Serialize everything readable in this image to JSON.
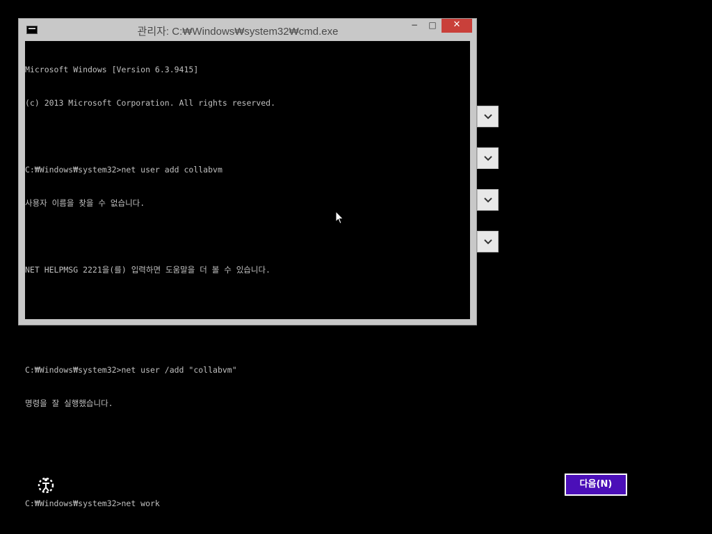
{
  "window": {
    "title": "관리자: C:₩Windows₩system32₩cmd.exe",
    "minimize_glyph": "−",
    "maximize_glyph": "□",
    "close_glyph": "✕"
  },
  "console": {
    "lines": [
      "Microsoft Windows [Version 6.3.9415]",
      "(c) 2013 Microsoft Corporation. All rights reserved.",
      "",
      "C:₩Windows₩system32>net user add collabvm",
      "사용자 이름을 찾을 수 없습니다.",
      "",
      "NET HELPMSG 2221을(를) 입력하면 도움말을 더 볼 수 있습니다.",
      "",
      "",
      "C:₩Windows₩system32>net user /add \"collabvm\"",
      "명령을 잘 실행했습니다.",
      "",
      "",
      "C:₩Windows₩system32>net work"
    ]
  },
  "icons": {
    "app": "cmd-icon",
    "dropdown": "chevron-down-icon",
    "ease_of_access": "ease-of-access-icon",
    "pointer": "mouse-pointer-icon"
  },
  "footer": {
    "next_label": "다음(N)"
  },
  "colors": {
    "next_button": "#4b0fb8",
    "close_button": "#c9403a",
    "console_bg": "#000000",
    "console_text": "#c0c0c0"
  }
}
